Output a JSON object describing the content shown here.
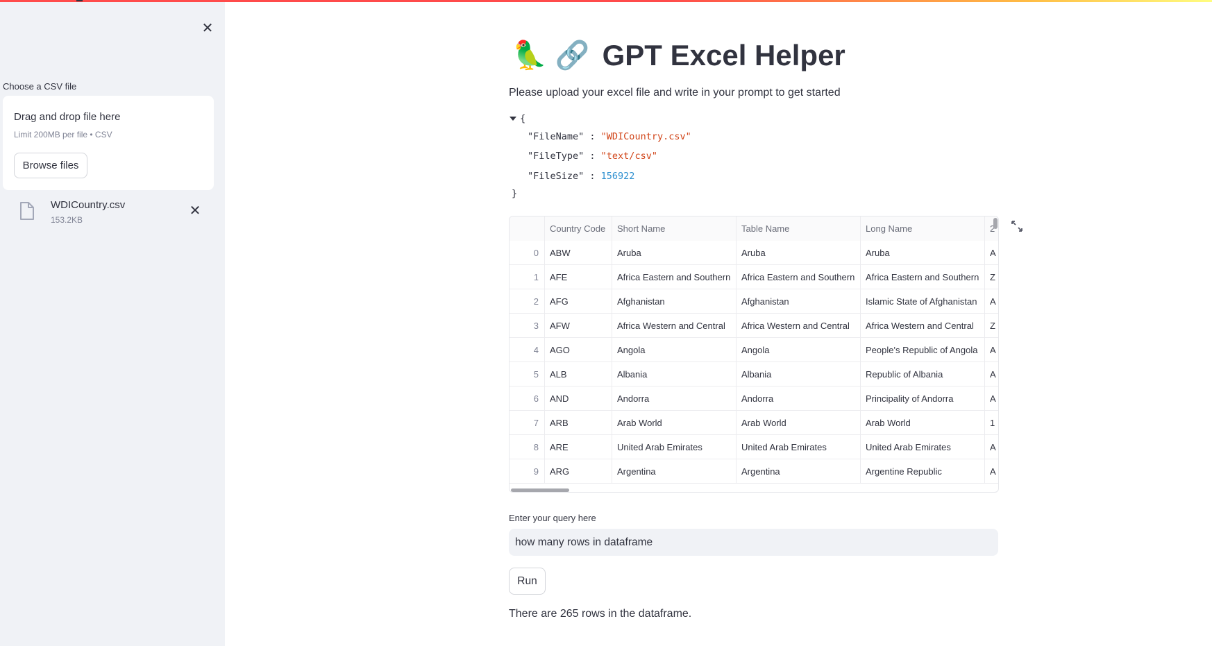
{
  "colors": {
    "accent": "#ff4b4b",
    "sidebar_bg": "#f0f2f6",
    "json_string": "#d14418",
    "json_number": "#2d8fcf"
  },
  "sidebar": {
    "close_icon": "close-icon",
    "uploader_label": "Choose a CSV file",
    "dropzone_title": "Drag and drop file here",
    "dropzone_limit": "Limit 200MB per file • CSV",
    "browse_label": "Browse files",
    "file": {
      "name": "WDICountry.csv",
      "size": "153.2KB",
      "icon": "file-icon",
      "remove_icon": "close-icon"
    }
  },
  "main": {
    "title_emoji_1": "🦜",
    "title_emoji_2": "🔗",
    "title": "GPT Excel Helper",
    "subtitle": "Please upload your excel file and write in your prompt to get started",
    "json": {
      "open": "{",
      "close": "}",
      "entries": [
        {
          "key": "\"FileName\"",
          "value": "\"WDICountry.csv\"",
          "type": "string"
        },
        {
          "key": "\"FileType\"",
          "value": "\"text/csv\"",
          "type": "string"
        },
        {
          "key": "\"FileSize\"",
          "value": "156922",
          "type": "number"
        }
      ]
    },
    "dataframe": {
      "columns": [
        "",
        "Country Code",
        "Short Name",
        "Table Name",
        "Long Name",
        "2"
      ],
      "rows": [
        [
          "0",
          "ABW",
          "Aruba",
          "Aruba",
          "Aruba",
          "A"
        ],
        [
          "1",
          "AFE",
          "Africa Eastern and Southern",
          "Africa Eastern and Southern",
          "Africa Eastern and Southern",
          "Z"
        ],
        [
          "2",
          "AFG",
          "Afghanistan",
          "Afghanistan",
          "Islamic State of Afghanistan",
          "A"
        ],
        [
          "3",
          "AFW",
          "Africa Western and Central",
          "Africa Western and Central",
          "Africa Western and Central",
          "Z"
        ],
        [
          "4",
          "AGO",
          "Angola",
          "Angola",
          "People's Republic of Angola",
          "A"
        ],
        [
          "5",
          "ALB",
          "Albania",
          "Albania",
          "Republic of Albania",
          "A"
        ],
        [
          "6",
          "AND",
          "Andorra",
          "Andorra",
          "Principality of Andorra",
          "A"
        ],
        [
          "7",
          "ARB",
          "Arab World",
          "Arab World",
          "Arab World",
          "1"
        ],
        [
          "8",
          "ARE",
          "United Arab Emirates",
          "United Arab Emirates",
          "United Arab Emirates",
          "A"
        ],
        [
          "9",
          "ARG",
          "Argentina",
          "Argentina",
          "Argentine Republic",
          "A"
        ]
      ],
      "expand_icon": "fullscreen-icon"
    },
    "query_label": "Enter your query here",
    "query_value": "how many rows in dataframe",
    "run_label": "Run",
    "answer": "There are 265 rows in the dataframe."
  }
}
